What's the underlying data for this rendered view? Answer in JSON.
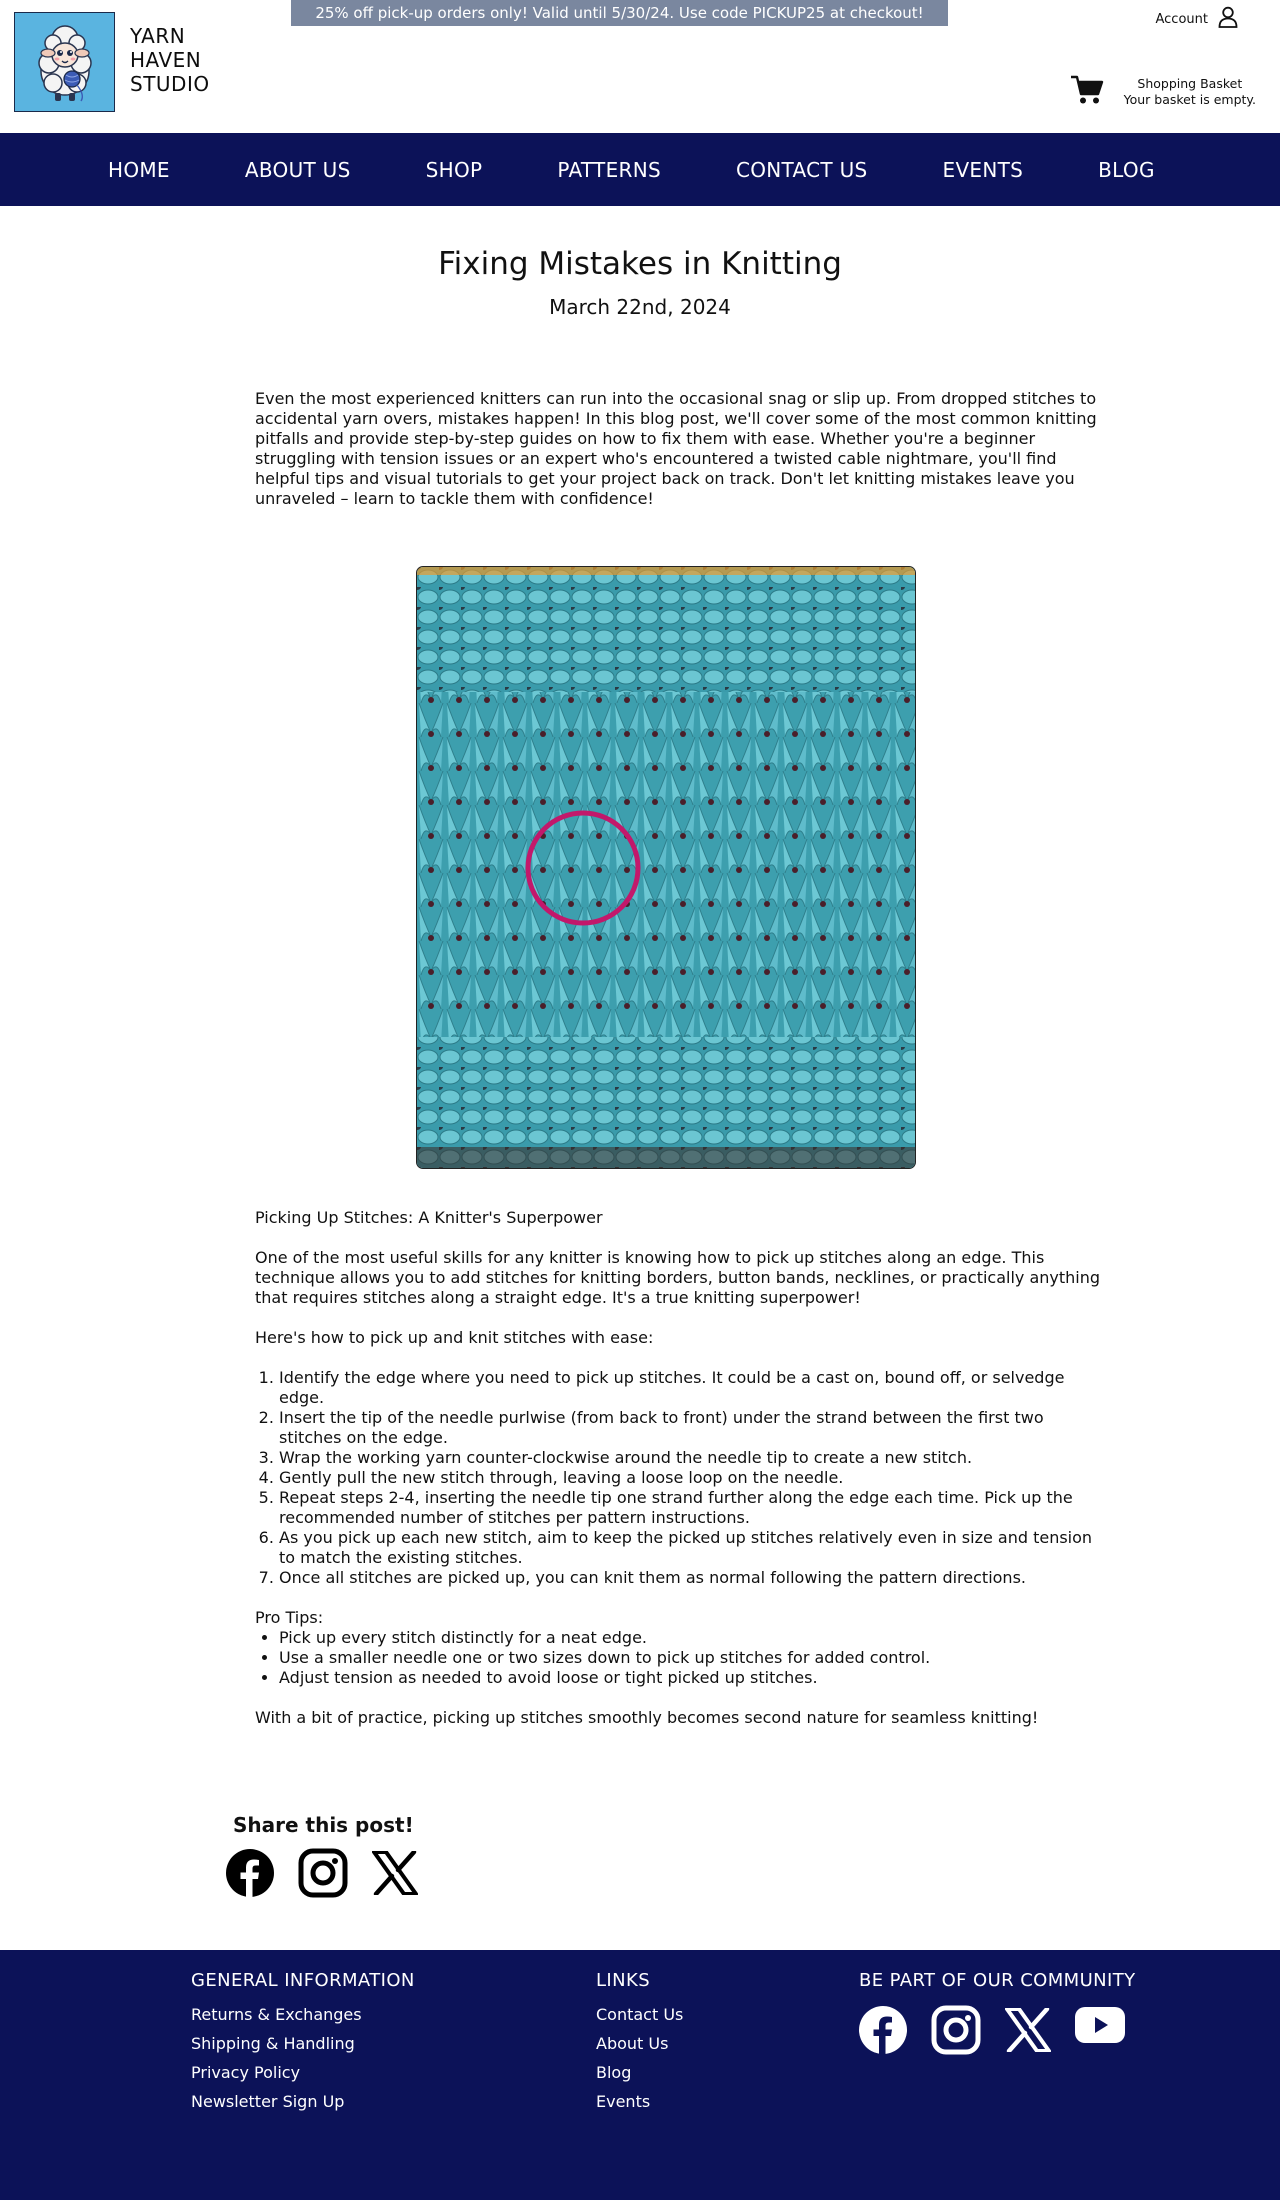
{
  "header": {
    "logo_lines": [
      "YARN",
      "HAVEN",
      "STUDIO"
    ],
    "promo": "25% off pick-up orders only! Valid until 5/30/24. Use code PICKUP25 at checkout!",
    "account_label": "Account",
    "basket_title": "Shopping Basket",
    "basket_status": "Your basket is empty."
  },
  "nav": [
    "HOME",
    "ABOUT US",
    "SHOP",
    "PATTERNS",
    "CONTACT US",
    "EVENTS",
    "BLOG"
  ],
  "post": {
    "title": "Fixing Mistakes in Knitting",
    "date": "March 22nd, 2024",
    "intro": "Even the most experienced knitters can run into the occasional snag or slip up. From dropped stitches to accidental yarn overs, mistakes happen! In this blog post, we'll cover some of the most common knitting pitfalls and provide step-by-step guides on how to fix them with ease. Whether you're a beginner struggling with tension issues or an expert who's encountered a twisted cable nightmare, you'll find helpful tips and visual tutorials to get your project back on track. Don't let knitting mistakes leave you unraveled – learn to tackle them with confidence!",
    "section_title": "Picking Up Stitches: A Knitter's Superpower",
    "section_body": "One of the most useful skills for any knitter is knowing how to pick up stitches along an edge. This technique allows you to add stitches for knitting borders, button bands, necklines, or practically anything that requires stitches along a straight edge. It's a true knitting superpower!",
    "steps_intro": "Here's how to pick up and knit stitches with ease:",
    "steps": [
      "Identify the edge where you need to pick up stitches. It could be a cast on, bound off, or selvedge edge.",
      "Insert the tip of the needle purlwise (from back to front) under the strand between the first two stitches on the edge.",
      "Wrap the working yarn counter-clockwise around the needle tip to create a new stitch.",
      "Gently pull the new stitch through, leaving a loose loop on the needle.",
      "Repeat steps 2-4, inserting the needle tip one strand further along the edge each time. Pick up the recommended number of stitches per pattern instructions.",
      "As you pick up each new stitch, aim to keep the picked up stitches relatively even in size and tension to match the existing stitches.",
      "Once all stitches are picked up, you can knit them as normal following the pattern directions."
    ],
    "tips_title": "Pro Tips:",
    "tips": [
      "Pick up every stitch distinctly for a neat edge.",
      "Use a smaller needle one or two sizes down to pick up stitches for added control.",
      "Adjust tension as needed to avoid loose or tight picked up stitches."
    ],
    "closing": "With a bit of practice, picking up stitches smoothly becomes second nature for seamless knitting!"
  },
  "share": {
    "title": "Share this post!"
  },
  "footer": {
    "general": {
      "heading": "GENERAL INFORMATION",
      "links": [
        "Returns & Exchanges",
        "Shipping & Handling",
        "Privacy Policy",
        "Newsletter Sign Up"
      ]
    },
    "links": {
      "heading": "LINKS",
      "links": [
        "Contact Us",
        "About Us",
        "Blog",
        "Events"
      ]
    },
    "community": {
      "heading": "BE PART OF OUR COMMUNITY"
    }
  },
  "colors": {
    "navy": "#0c1258",
    "promo_bg": "#7a879f",
    "logo_bg": "#5ab4e0",
    "yarn": "#4fb3c2",
    "highlight_circle": "#c2186b"
  },
  "icons": [
    "sheep-logo",
    "user-icon",
    "cart-icon",
    "facebook-icon",
    "instagram-icon",
    "x-icon",
    "youtube-icon"
  ]
}
